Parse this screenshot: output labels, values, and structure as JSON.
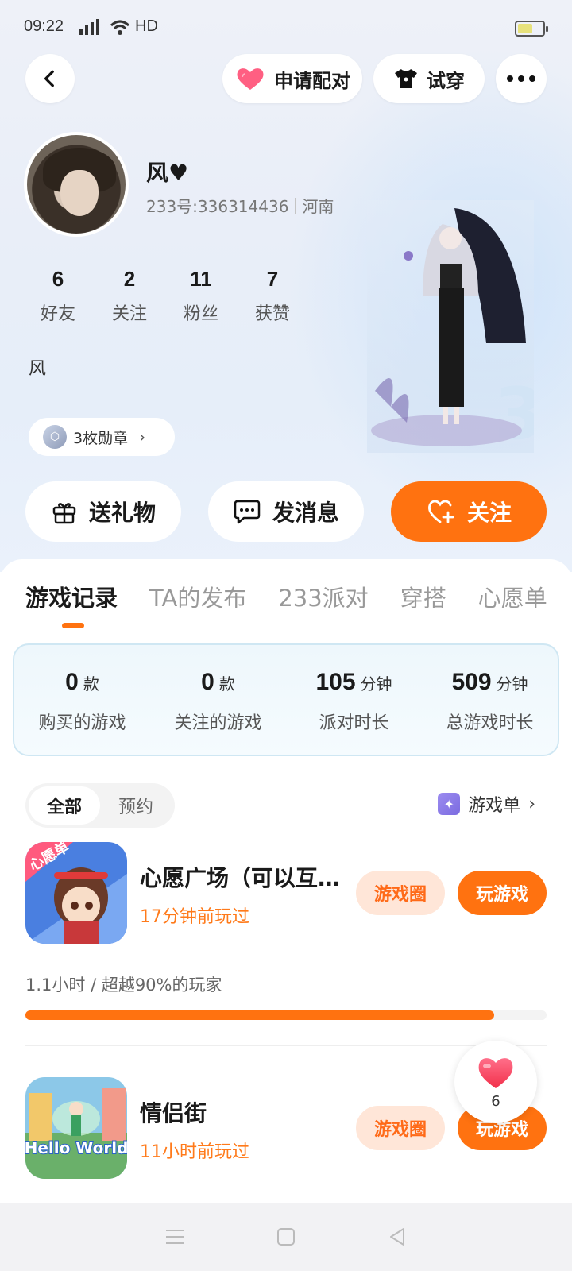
{
  "status_bar": {
    "time": "09:22",
    "network": "4G",
    "hd": "HD",
    "battery_percent": 60
  },
  "header": {
    "pair_label": "申请配对",
    "try_label": "试穿"
  },
  "profile": {
    "nickname": "风♥",
    "uid": "233号:336314436",
    "region": "河南",
    "bio": "风",
    "badges_label": "3枚勋章",
    "stats": [
      {
        "value": "6",
        "label": "好友"
      },
      {
        "value": "2",
        "label": "关注"
      },
      {
        "value": "11",
        "label": "粉丝"
      },
      {
        "value": "7",
        "label": "获赞"
      }
    ]
  },
  "actions": {
    "gift_label": "送礼物",
    "message_label": "发消息",
    "follow_label": "关注"
  },
  "tabs": [
    "游戏记录",
    "TA的发布",
    "233派对",
    "穿搭",
    "心愿单"
  ],
  "summary": [
    {
      "value": "0",
      "unit": "款",
      "label": "购买的游戏"
    },
    {
      "value": "0",
      "unit": "款",
      "label": "关注的游戏"
    },
    {
      "value": "105",
      "unit": "分钟",
      "label": "派对时长"
    },
    {
      "value": "509",
      "unit": "分钟",
      "label": "总游戏时长"
    }
  ],
  "filter": {
    "all": "全部",
    "reserved": "预约"
  },
  "game_list_link": "游戏单",
  "games": [
    {
      "title": "心愿广场（可以互…",
      "icon_badge": "心愿单",
      "played": "17分钟前玩过",
      "circle_label": "游戏圈",
      "play_label": "玩游戏",
      "progress_text": "1.1小时 / 超越90%的玩家",
      "progress_fraction": 0.9
    },
    {
      "title": "情侣街",
      "icon_text": "Hello World",
      "played": "11小时前玩过",
      "circle_label": "游戏圈",
      "play_label": "玩游戏"
    }
  ],
  "like_fab": {
    "count": "6"
  },
  "colors": {
    "accent": "#ff7210",
    "accent_light": "#ffe6d8",
    "played_text": "#ff7a1a"
  },
  "icons": {
    "back": "back-arrow-icon",
    "pair": "heart-icon",
    "try": "shirt-icon",
    "more": "more-dots-icon",
    "gift": "gift-icon",
    "message": "chat-bubble-icon",
    "follow": "heart-plus-icon",
    "badge": "medal-icon",
    "game_list": "sparkle-icon",
    "like": "heart-icon"
  }
}
